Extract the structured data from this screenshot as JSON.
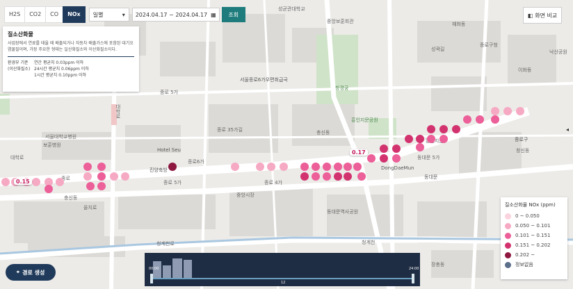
{
  "gas_tabs": [
    {
      "label": "H2S",
      "active": false
    },
    {
      "label": "CO2",
      "active": false
    },
    {
      "label": "CO",
      "active": false
    },
    {
      "label": "NOx",
      "active": true
    }
  ],
  "period_select": {
    "value": "일별",
    "icon": "chevron-down-icon"
  },
  "date_range": {
    "value": "2024.04.17 ~ 2024.04.17",
    "icon": "calendar-icon"
  },
  "search_label": "조회",
  "compare_button": {
    "label": "화면 비교",
    "icon": "split-screen-icon"
  },
  "info": {
    "title": "질소산화물",
    "description": "사업장에서 연료를 태울 때 배출되거나 자동차 배출가스에 포함된 대기오염물질이며, 가장 주요한 형태는 일산화질소와 이산화질소이다.",
    "rows": [
      {
        "k": "환경부 기준",
        "v": "연간 평균치 0.03ppm 이하"
      },
      {
        "k": "(이산화질소)",
        "v": "24시간 평균치 0.06ppm 이하"
      },
      {
        "k": "",
        "v": "1시간 평균치 0.10ppm 이하"
      }
    ]
  },
  "legend": {
    "title": "질소산화물 NOx (ppm)",
    "items": [
      {
        "label": "0 ~ 0.050",
        "color": "#fbd3df"
      },
      {
        "label": "0.050 ~ 0.101",
        "color": "#f6a9c3"
      },
      {
        "label": "0.101 ~ 0.151",
        "color": "#ec5f98"
      },
      {
        "label": "0.151 ~ 0.202",
        "color": "#d2336f"
      },
      {
        "label": "0.202 ~",
        "color": "#8e1840"
      },
      {
        "label": "정보없음",
        "color": "#5b6e8a"
      }
    ]
  },
  "route_button": {
    "label": "경로 생성",
    "icon": "location-pin-icon"
  },
  "timeline": {
    "start": "00:00",
    "end": "24:00",
    "current": "12"
  },
  "value_labels": [
    "0.15",
    "0.17"
  ],
  "map_labels": [
    "성균관대학교",
    "중앙보훈회관",
    "대학로",
    "종로 35가길",
    "종로",
    "진양축방",
    "종로 5가",
    "종로 4가",
    "서울종로6가우편취급국",
    "종로 5가",
    "창경궁",
    "동대문 5가",
    "DongDaeMun",
    "흥인지문공원",
    "동대문",
    "종로구",
    "종로구청",
    "충신동",
    "혜화동",
    "이화동",
    "창신동",
    "흥인지문",
    "대학로",
    "청계천로",
    "청계천",
    "을지로",
    "동대문역사공원",
    "장충동",
    "성곽길",
    "낙산공원",
    "Hotel Seu",
    "중앙시장",
    "충신동",
    "종로6가",
    "서울대학교병원",
    "보훈병원"
  ]
}
